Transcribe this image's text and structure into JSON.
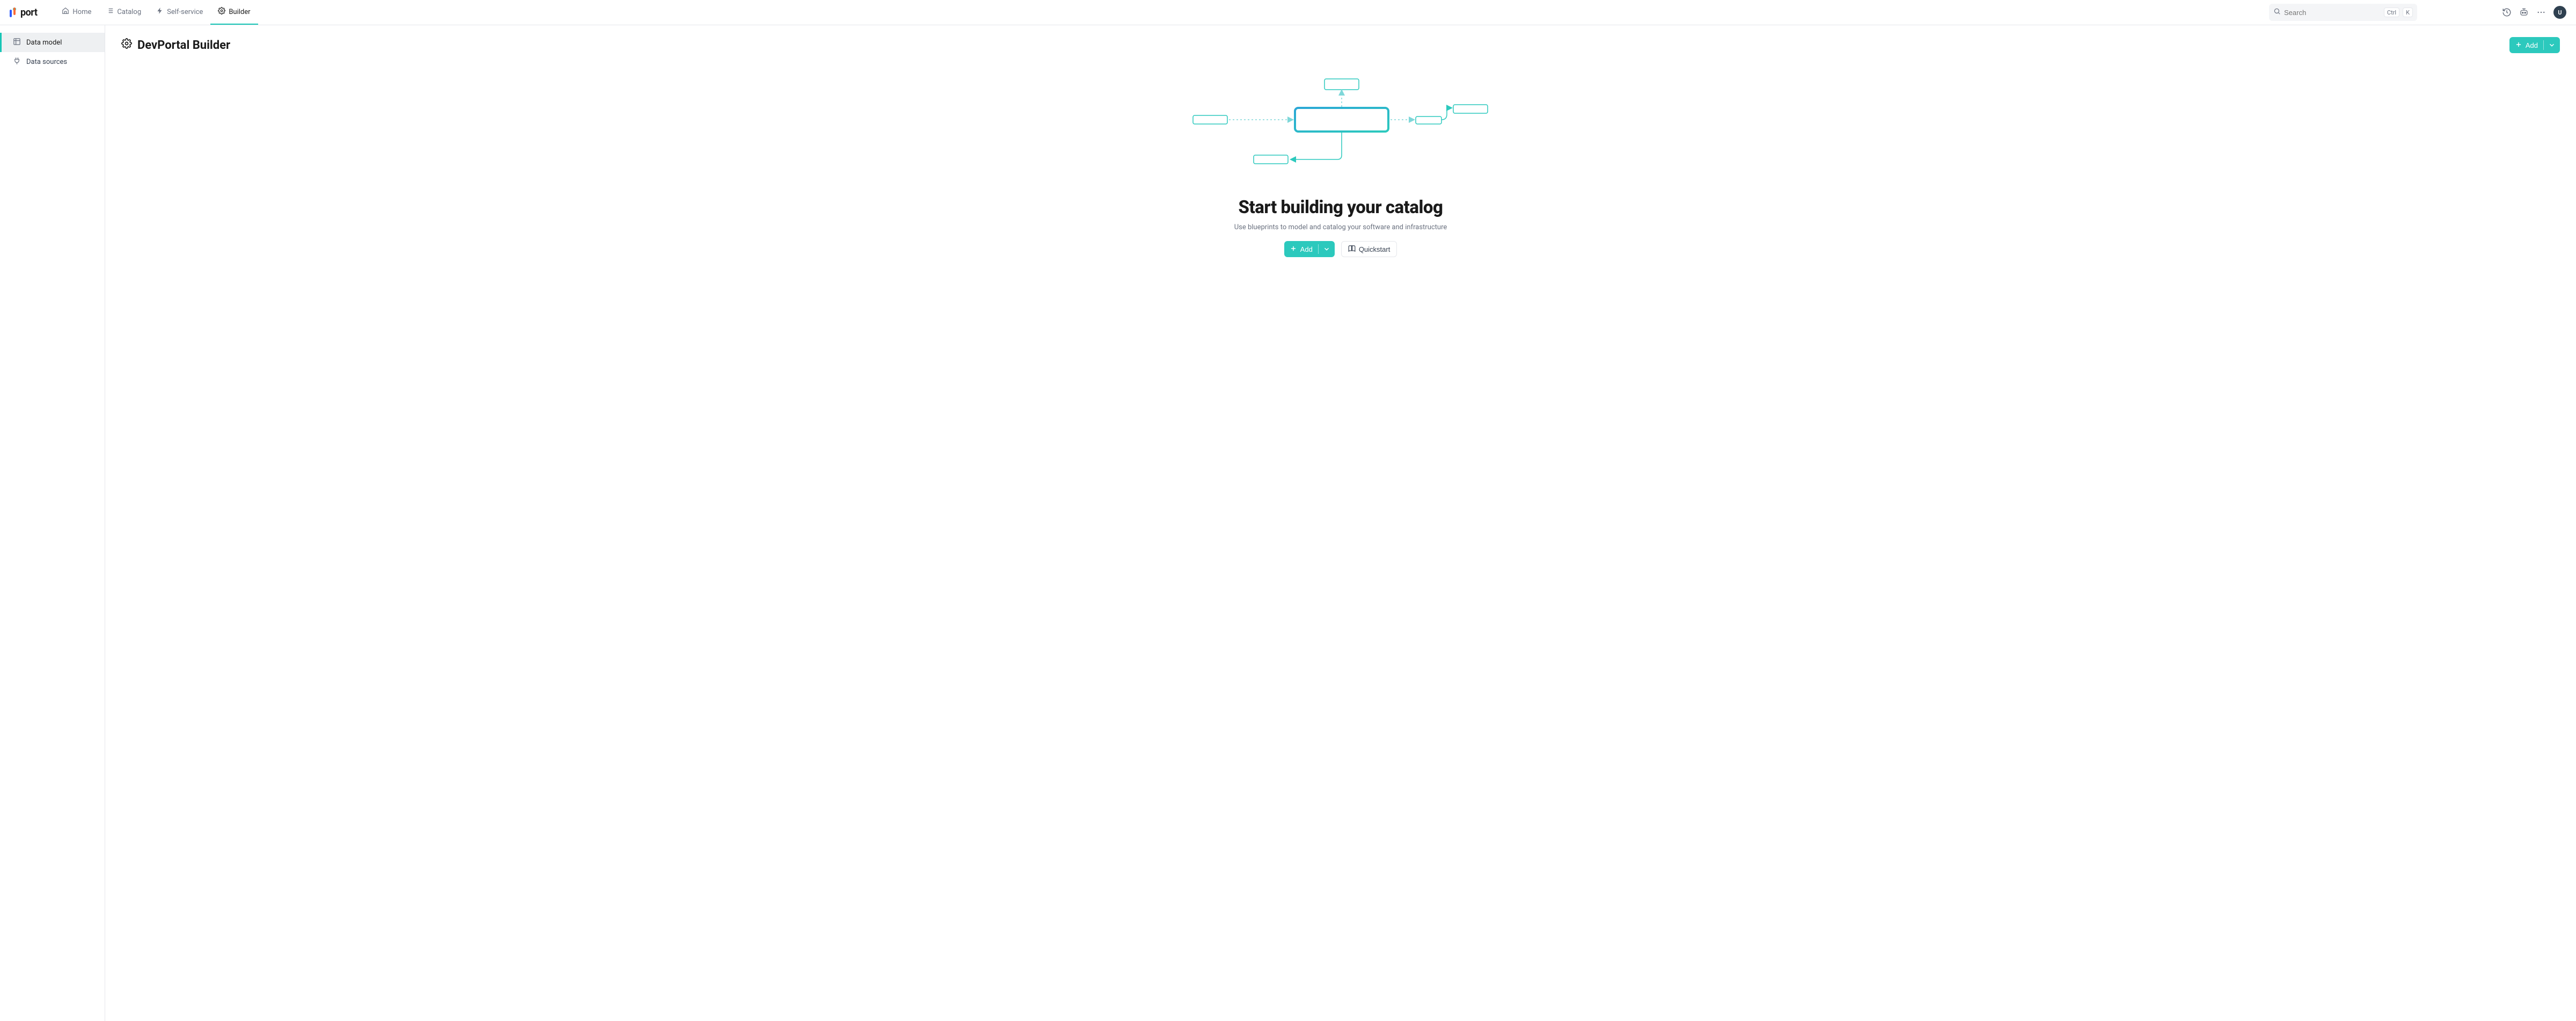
{
  "brand": {
    "name": "port"
  },
  "nav": {
    "home": "Home",
    "catalog": "Catalog",
    "self": "Self-service",
    "builder": "Builder"
  },
  "search": {
    "placeholder": "Search",
    "kbd_ctrl": "Ctrl",
    "kbd_k": "K"
  },
  "avatar": {
    "initial": "U"
  },
  "sidebar": {
    "data_model": "Data model",
    "data_sources": "Data sources"
  },
  "page": {
    "title": "DevPortal Builder",
    "add": "Add"
  },
  "empty": {
    "heading": "Start building your catalog",
    "sub": "Use blueprints to model and catalog your software and infrastructure",
    "add": "Add",
    "quickstart": "Quickstart"
  }
}
